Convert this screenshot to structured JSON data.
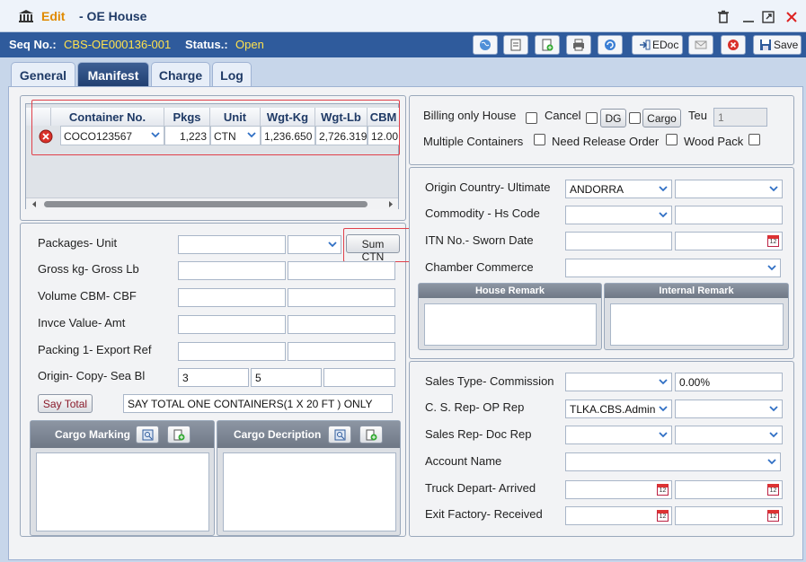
{
  "window": {
    "edit_label": "Edit",
    "title": "- OE House"
  },
  "seq": {
    "seq_label": "Seq No.:",
    "seq_value": "CBS-OE000136-001",
    "status_label": "Status.:",
    "status_value": "Open"
  },
  "toolbar": {
    "edoc_label": "EDoc",
    "save_label": "Save"
  },
  "tabs": [
    "General",
    "Manifest",
    "Charge",
    "Log"
  ],
  "grid": {
    "headers": [
      "Container No.",
      "Pkgs",
      "Unit",
      "Wgt-Kg",
      "Wgt-Lb",
      "CBM"
    ],
    "row": {
      "container": "COCO123567",
      "pkgs": "1,223",
      "unit": "CTN",
      "wgt_kg": "1,236.650",
      "wgt_lb": "2,726.319",
      "cbm": "12.00"
    }
  },
  "flags": {
    "billing_only_house": "Billing only House",
    "cancel": "Cancel",
    "dg": "DG",
    "cargo": "Cargo",
    "teu_label": "Teu",
    "teu_value": "1",
    "multiple_containers": "Multiple Containers",
    "need_release_order": "Need Release Order",
    "wood_pack": "Wood Pack"
  },
  "left": {
    "packages_unit": "Packages- Unit",
    "sum_ctn": "Sum CTN",
    "gross": "Gross kg- Gross Lb",
    "volume": "Volume CBM- CBF",
    "invoice": "Invce Value- Amt",
    "packing": "Packing 1-  Export Ref",
    "origin_copy": "Origin- Copy- Sea Bl",
    "origin_value": "3",
    "copy_value": "5",
    "say_total_button": "Say Total",
    "say_total_text": "SAY TOTAL ONE CONTAINERS(1 X 20 FT ) ONLY",
    "cargo_marking": "Cargo Marking",
    "cargo_description": "Cargo Decription"
  },
  "right": {
    "origin_country": "Origin Country- Ultimate",
    "origin_country_value": "ANDORRA",
    "commodity": "Commodity -  Hs Code",
    "itn": "ITN No.- Sworn Date",
    "chamber": "Chamber Commerce",
    "house_remark": "House Remark",
    "internal_remark": "Internal Remark",
    "sales_type": "Sales Type- Commission",
    "commission_value": "0.00%",
    "cs_rep": "C. S. Rep- OP Rep",
    "cs_rep_value": "TLKA.CBS.Admin",
    "sales_rep": "Sales Rep- Doc Rep",
    "account_name": "Account Name",
    "truck": "Truck Depart-  Arrived",
    "exit_factory": "Exit Factory- Received"
  },
  "colors": {
    "accent": "#2f5b9c",
    "status": "#ffe24d",
    "highlight": "#e0404a"
  }
}
